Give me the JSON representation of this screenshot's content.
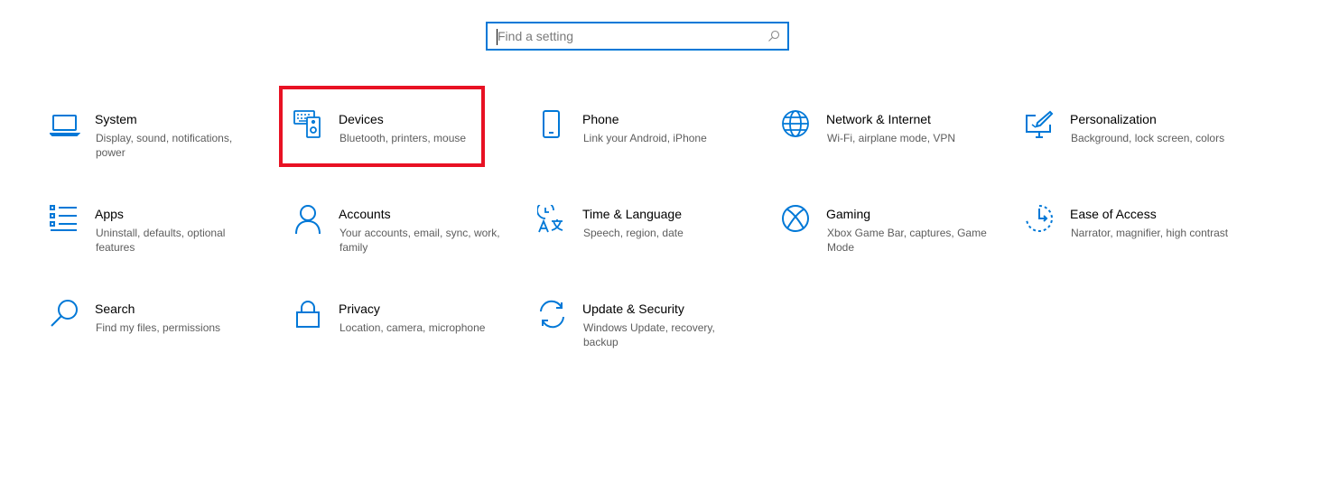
{
  "search": {
    "placeholder": "Find a setting",
    "value": ""
  },
  "colors": {
    "accent": "#0078d7",
    "highlight": "#e81123",
    "description": "#5d5d5d"
  },
  "categories": [
    {
      "title": "System",
      "description": "Display, sound, notifications, power",
      "icon": "laptop-icon"
    },
    {
      "title": "Devices",
      "description": "Bluetooth, printers, mouse",
      "icon": "devices-icon"
    },
    {
      "title": "Phone",
      "description": "Link your Android, iPhone",
      "icon": "phone-icon"
    },
    {
      "title": "Network & Internet",
      "description": "Wi-Fi, airplane mode, VPN",
      "icon": "globe-icon"
    },
    {
      "title": "Personalization",
      "description": "Background, lock screen, colors",
      "icon": "paintbrush-icon"
    },
    {
      "title": "Apps",
      "description": "Uninstall, defaults, optional features",
      "icon": "apps-list-icon"
    },
    {
      "title": "Accounts",
      "description": "Your accounts, email, sync, work, family",
      "icon": "person-icon"
    },
    {
      "title": "Time & Language",
      "description": "Speech, region, date",
      "icon": "time-language-icon"
    },
    {
      "title": "Gaming",
      "description": "Xbox Game Bar, captures, Game Mode",
      "icon": "xbox-icon"
    },
    {
      "title": "Ease of Access",
      "description": "Narrator, magnifier, high contrast",
      "icon": "ease-of-access-icon"
    },
    {
      "title": "Search",
      "description": "Find my files, permissions",
      "icon": "search-icon"
    },
    {
      "title": "Privacy",
      "description": "Location, camera, microphone",
      "icon": "lock-icon"
    },
    {
      "title": "Update & Security",
      "description": "Windows Update, recovery, backup",
      "icon": "sync-icon"
    }
  ]
}
